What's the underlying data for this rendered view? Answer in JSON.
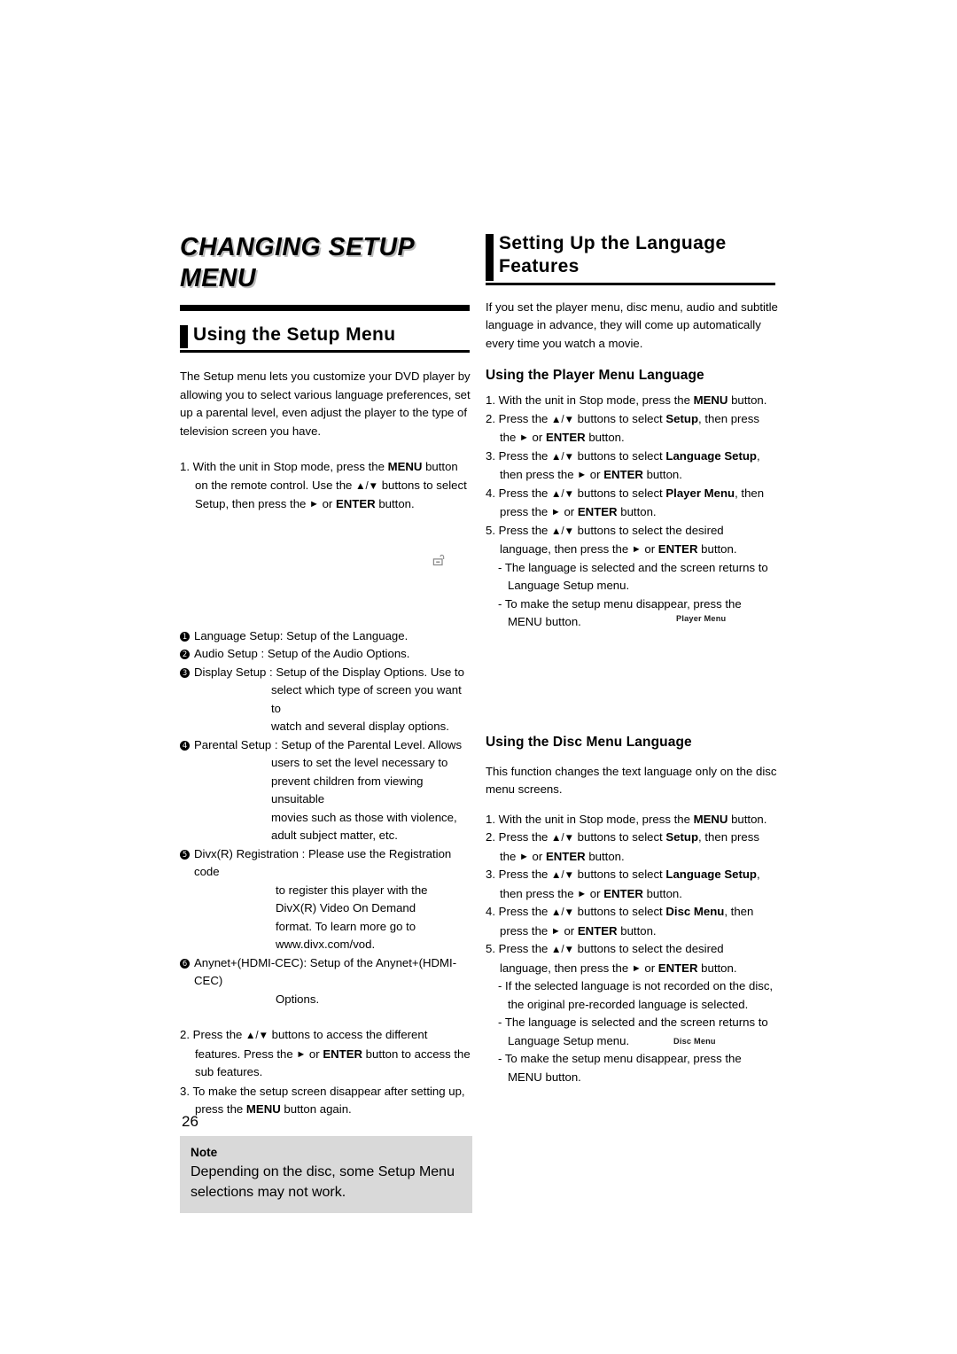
{
  "page": {
    "number": "26"
  },
  "left_column": {
    "chapter_title": "CHANGING SETUP MENU",
    "section_heading": "Using the Setup Menu",
    "intro": "The Setup menu lets you customize your DVD player by allowing you to select various language preferences, set up a parental level, even adjust the player to the type of television screen you have.",
    "step1": {
      "num": "1.",
      "part_a": "With the unit in Stop mode, press the ",
      "bold_menu": "MENU",
      "part_b": " button on the remote control.  Use the ",
      "updown": "▲/▼",
      "part_c": " buttons to select Setup, then press the ",
      "right_arrow": "►",
      "part_d": " or ",
      "bold_enter": "ENTER",
      "part_e": " button."
    },
    "lock_icon_label": "padlock",
    "feature_items": [
      {
        "marker": "1",
        "label": "Language Setup: Setup of the Language.",
        "continuations": []
      },
      {
        "marker": "2",
        "label": "Audio Setup : Setup of the Audio Options.",
        "continuations": []
      },
      {
        "marker": "3",
        "label": "Display Setup : Setup of the Display Options. Use to",
        "continuations": [
          "select which type of screen you want to",
          "watch and several display options."
        ]
      },
      {
        "marker": "4",
        "label": "Parental Setup : Setup of the Parental Level. Allows",
        "continuations": [
          "users to set the level necessary to",
          "prevent children from viewing unsuitable",
          "movies such as those with violence,",
          "adult subject matter, etc."
        ]
      },
      {
        "marker": "5",
        "label": "Divx(R) Registration : Please use the Registration code",
        "continuations": [
          "to register this player with the",
          "DivX(R) Video On Demand",
          "format. To learn more go to",
          "www.divx.com/vod."
        ]
      },
      {
        "marker": "6",
        "label": "Anynet+(HDMI-CEC): Setup of the Anynet+(HDMI-CEC)",
        "continuations": [
          "Options."
        ]
      }
    ],
    "step2": {
      "num": "2.",
      "part_a": "Press the ",
      "updown": "▲/▼",
      "part_b": " buttons to access the different  features. Press the ",
      "right_arrow": "►",
      "part_c": " or ",
      "bold_enter": "ENTER",
      "part_d": " button to access the sub features."
    },
    "step3": {
      "num": "3.",
      "part_a": "To make the setup screen disappear after setting up, press the ",
      "bold_menu": "MENU",
      "part_b": " button again."
    },
    "note": {
      "title": "Note",
      "body": "Depending on the disc, some Setup Menu selections may not work."
    }
  },
  "right_column": {
    "section_heading": "Setting Up the Language Features",
    "intro": "If you set the player menu, disc menu, audio and subtitle language in advance, they will come up automatically every time you watch a movie.",
    "player_menu": {
      "sub_heading": "Using the Player Menu Language",
      "steps": [
        {
          "num": "1.",
          "segments": [
            {
              "t": "With the unit in Stop mode, press the ",
              "b": false
            },
            {
              "t": "MENU",
              "b": true
            },
            {
              "t": " button.",
              "b": false
            }
          ]
        },
        {
          "num": "2.",
          "segments": [
            {
              "t": "Press the ",
              "b": false
            },
            {
              "t": "▲/▼",
              "b": false,
              "sym": true
            },
            {
              "t": " buttons to select ",
              "b": false
            },
            {
              "t": "Setup",
              "b": true
            },
            {
              "t": ", then press the ",
              "b": false
            },
            {
              "t": "►",
              "b": false,
              "sym": true
            },
            {
              "t": " or ",
              "b": false
            },
            {
              "t": "ENTER",
              "b": true
            },
            {
              "t": " button.",
              "b": false
            }
          ]
        },
        {
          "num": "3.",
          "segments": [
            {
              "t": "Press the ",
              "b": false
            },
            {
              "t": "▲/▼",
              "b": false,
              "sym": true
            },
            {
              "t": " buttons to select ",
              "b": false
            },
            {
              "t": "Language Setup",
              "b": true
            },
            {
              "t": ", then press the ",
              "b": false
            },
            {
              "t": "►",
              "b": false,
              "sym": true
            },
            {
              "t": " or ",
              "b": false
            },
            {
              "t": "ENTER",
              "b": true
            },
            {
              "t": " button.",
              "b": false
            }
          ]
        },
        {
          "num": "4.",
          "segments": [
            {
              "t": "Press the ",
              "b": false
            },
            {
              "t": "▲/▼",
              "b": false,
              "sym": true
            },
            {
              "t": " buttons to select ",
              "b": false
            },
            {
              "t": "Player Menu",
              "b": true
            },
            {
              "t": ", then press the ",
              "b": false
            },
            {
              "t": "►",
              "b": false,
              "sym": true
            },
            {
              "t": " or ",
              "b": false
            },
            {
              "t": "ENTER",
              "b": true
            },
            {
              "t": " button.",
              "b": false
            }
          ]
        },
        {
          "num": "5.",
          "segments": [
            {
              "t": "Press the ",
              "b": false
            },
            {
              "t": "▲/▼",
              "b": false,
              "sym": true
            },
            {
              "t": " buttons to select the desired language, then press the ",
              "b": false
            },
            {
              "t": "►",
              "b": false,
              "sym": true
            },
            {
              "t": " or ",
              "b": false
            },
            {
              "t": "ENTER",
              "b": true
            },
            {
              "t": " button.",
              "b": false
            }
          ]
        }
      ],
      "sub_notes": [
        "The language is selected and the screen returns to Language Setup menu.",
        "To make the setup menu disappear, press the MENU button."
      ],
      "screen_caption": "Player Menu"
    },
    "disc_menu": {
      "sub_heading": "Using the Disc Menu Language",
      "intro": "This function changes the text language only on the disc menu screens.",
      "steps": [
        {
          "num": "1.",
          "segments": [
            {
              "t": "With the unit in Stop mode, press the ",
              "b": false
            },
            {
              "t": "MENU",
              "b": true
            },
            {
              "t": " button.",
              "b": false
            }
          ]
        },
        {
          "num": "2.",
          "segments": [
            {
              "t": "Press the ",
              "b": false
            },
            {
              "t": "▲/▼",
              "b": false,
              "sym": true
            },
            {
              "t": " buttons to select ",
              "b": false
            },
            {
              "t": "Setup",
              "b": true
            },
            {
              "t": ", then press the ",
              "b": false
            },
            {
              "t": "►",
              "b": false,
              "sym": true
            },
            {
              "t": " or ",
              "b": false
            },
            {
              "t": "ENTER",
              "b": true
            },
            {
              "t": " button.",
              "b": false
            }
          ]
        },
        {
          "num": "3.",
          "segments": [
            {
              "t": "Press the ",
              "b": false
            },
            {
              "t": "▲/▼",
              "b": false,
              "sym": true
            },
            {
              "t": " buttons to select ",
              "b": false
            },
            {
              "t": "Language Setup",
              "b": true
            },
            {
              "t": ", then press the ",
              "b": false
            },
            {
              "t": "►",
              "b": false,
              "sym": true
            },
            {
              "t": " or ",
              "b": false
            },
            {
              "t": "ENTER",
              "b": true
            },
            {
              "t": " button.",
              "b": false
            }
          ]
        },
        {
          "num": "4.",
          "segments": [
            {
              "t": "Press the  ",
              "b": false
            },
            {
              "t": "▲/▼",
              "b": false,
              "sym": true
            },
            {
              "t": " buttons to select ",
              "b": false
            },
            {
              "t": "Disc Menu",
              "b": true
            },
            {
              "t": ", then press the ",
              "b": false
            },
            {
              "t": "►",
              "b": false,
              "sym": true
            },
            {
              "t": " or ",
              "b": false
            },
            {
              "t": "ENTER",
              "b": true
            },
            {
              "t": "  button.",
              "b": false
            }
          ]
        },
        {
          "num": "5.",
          "segments": [
            {
              "t": "Press the ",
              "b": false
            },
            {
              "t": "▲/▼",
              "b": false,
              "sym": true
            },
            {
              "t": " buttons to select the desired language, then press the ",
              "b": false
            },
            {
              "t": "►",
              "b": false,
              "sym": true
            },
            {
              "t": " or ",
              "b": false
            },
            {
              "t": "ENTER",
              "b": true
            },
            {
              "t": " button.",
              "b": false
            }
          ]
        }
      ],
      "sub_notes": [
        "If the selected language is not recorded on  the disc, the original pre-recorded language is selected.",
        "The language is selected and the screen returns to Language Setup menu.",
        "To make the setup menu disappear, press the MENU button."
      ],
      "screen_caption": "Disc Menu"
    }
  },
  "colors": {
    "text": "#000000",
    "note_box_bg": "#d9d9d9",
    "title_shadow": "#bdbdbd",
    "lock_icon": "#8a8a8a"
  }
}
